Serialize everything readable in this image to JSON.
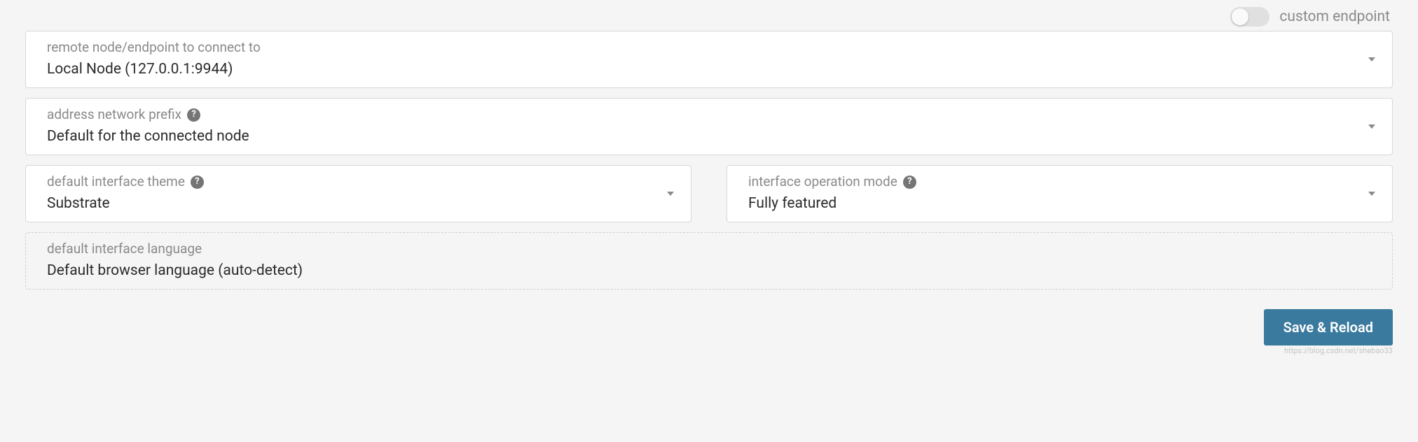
{
  "toggle": {
    "label": "custom endpoint"
  },
  "endpoint": {
    "label": "remote node/endpoint to connect to",
    "value": "Local Node (127.0.0.1:9944)"
  },
  "prefix": {
    "label": "address network prefix",
    "value": "Default for the connected node"
  },
  "theme": {
    "label": "default interface theme",
    "value": "Substrate"
  },
  "mode": {
    "label": "interface operation mode",
    "value": "Fully featured"
  },
  "language": {
    "label": "default interface language",
    "value": "Default browser language (auto-detect)"
  },
  "buttons": {
    "save": "Save & Reload"
  },
  "watermark": "https://blog.csdn.net/shebao33"
}
